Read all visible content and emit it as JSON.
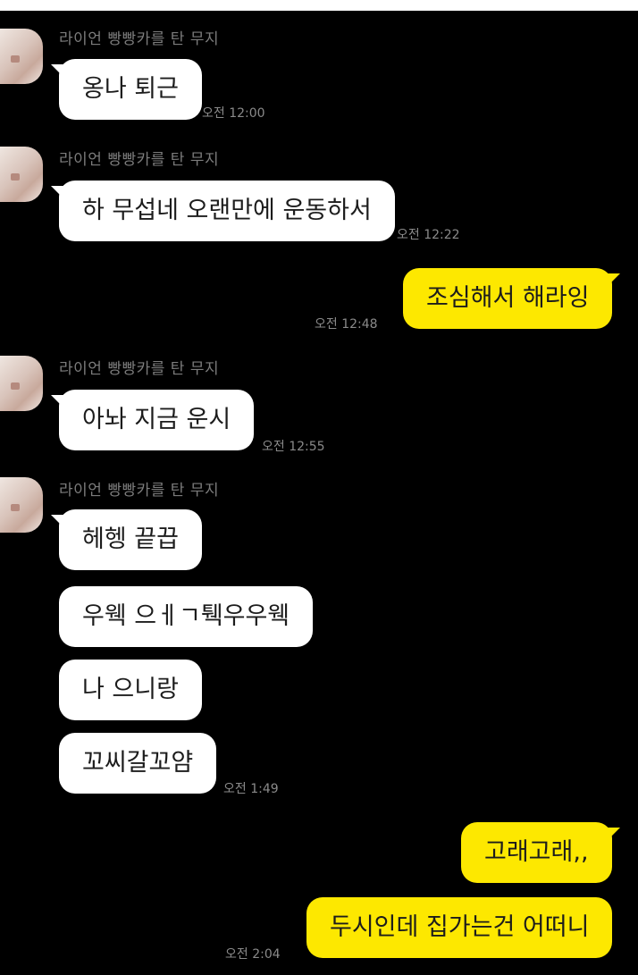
{
  "colors": {
    "background": "#000000",
    "incoming_bubble": "#ffffff",
    "outgoing_bubble": "#fde800",
    "sender_name": "#7c7c7c",
    "timestamp": "#8a8a8a",
    "message_text": "#1c1c1c"
  },
  "sender_name": "라이언 빵빵카를 탄 무지",
  "messages": [
    {
      "side": "in",
      "text": "옹나 퇴근",
      "time": "오전 12:00"
    },
    {
      "side": "in",
      "text": "하 무섭네 오랜만에 운동하서",
      "time": "오전 12:22"
    },
    {
      "side": "out",
      "text": "조심해서 해라잉",
      "time": "오전 12:48"
    },
    {
      "side": "in",
      "text": "아놔 지금 운시",
      "time": "오전 12:55"
    },
    {
      "side": "in",
      "text": "헤헹 끝끕"
    },
    {
      "side": "in",
      "text": "우웩 으ㅔㄱ퉥우우웩"
    },
    {
      "side": "in",
      "text": "나 으니랑"
    },
    {
      "side": "in",
      "text": "꼬씨갈꼬얌",
      "time": "오전 1:49"
    },
    {
      "side": "out",
      "text": "고래고래,,"
    },
    {
      "side": "out",
      "text": "두시인데 집가는건 어떠니",
      "time": "오전 2:04"
    }
  ]
}
